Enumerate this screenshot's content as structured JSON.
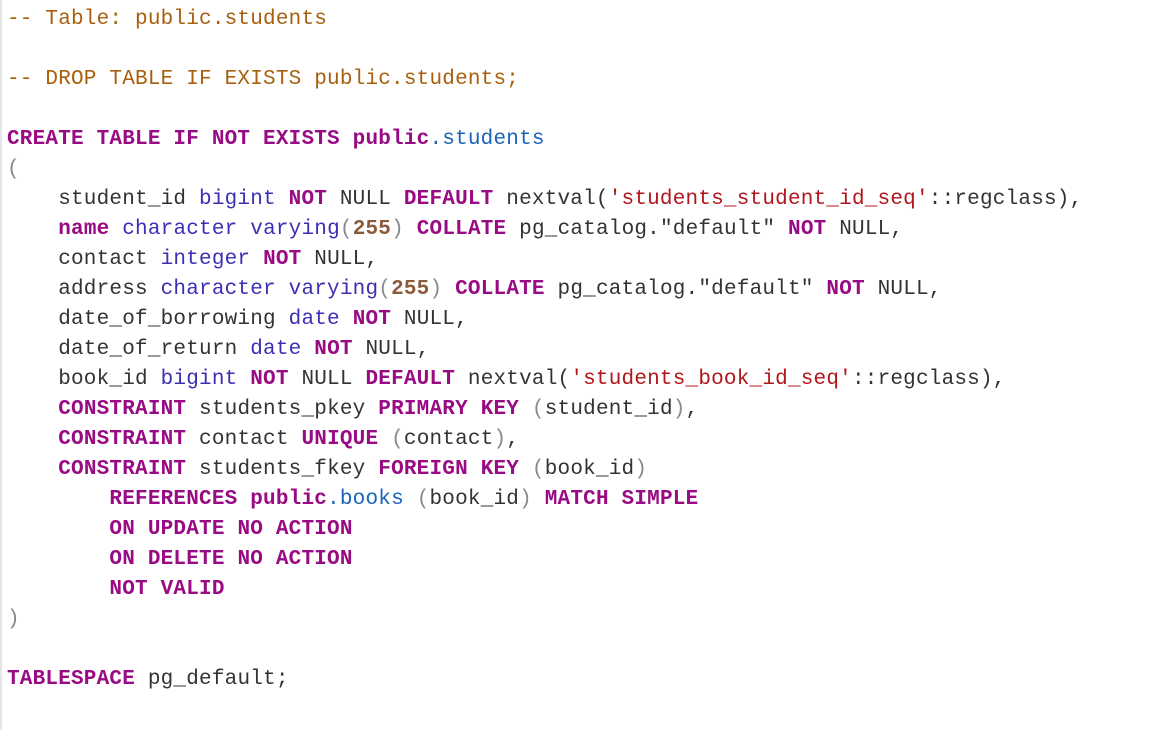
{
  "editor": {
    "colors": {
      "keyword": "#990b84",
      "type": "#3c2fb3",
      "number": "#8a5a3a",
      "string": "#b0161c",
      "comment": "#a8600e",
      "qualifier": "#1a63b8"
    },
    "lines": [
      [
        {
          "c": "cm",
          "t": "-- Table: public.students"
        }
      ],
      [],
      [
        {
          "c": "cm",
          "t": "-- DROP TABLE IF EXISTS public.students;"
        }
      ],
      [],
      [
        {
          "c": "kw",
          "t": "CREATE TABLE IF NOT EXISTS public"
        },
        {
          "c": "qual",
          "t": ".students"
        }
      ],
      [
        {
          "c": "paren",
          "t": "("
        }
      ],
      [
        {
          "c": "plain",
          "t": "    student_id "
        },
        {
          "c": "type",
          "t": "bigint"
        },
        {
          "c": "plain",
          "t": " "
        },
        {
          "c": "kw",
          "t": "NOT"
        },
        {
          "c": "plain",
          "t": " NULL "
        },
        {
          "c": "kw",
          "t": "DEFAULT"
        },
        {
          "c": "plain",
          "t": " nextval("
        },
        {
          "c": "str",
          "t": "'students_student_id_seq'"
        },
        {
          "c": "plain",
          "t": "::regclass),"
        }
      ],
      [
        {
          "c": "plain",
          "t": "    "
        },
        {
          "c": "kw",
          "t": "name"
        },
        {
          "c": "plain",
          "t": " "
        },
        {
          "c": "type",
          "t": "character varying"
        },
        {
          "c": "paren",
          "t": "("
        },
        {
          "c": "num",
          "t": "255"
        },
        {
          "c": "paren",
          "t": ")"
        },
        {
          "c": "plain",
          "t": " "
        },
        {
          "c": "kw",
          "t": "COLLATE"
        },
        {
          "c": "plain",
          "t": " pg_catalog.\"default\" "
        },
        {
          "c": "kw",
          "t": "NOT"
        },
        {
          "c": "plain",
          "t": " NULL,"
        }
      ],
      [
        {
          "c": "plain",
          "t": "    contact "
        },
        {
          "c": "type",
          "t": "integer"
        },
        {
          "c": "plain",
          "t": " "
        },
        {
          "c": "kw",
          "t": "NOT"
        },
        {
          "c": "plain",
          "t": " NULL,"
        }
      ],
      [
        {
          "c": "plain",
          "t": "    address "
        },
        {
          "c": "type",
          "t": "character varying"
        },
        {
          "c": "paren",
          "t": "("
        },
        {
          "c": "num",
          "t": "255"
        },
        {
          "c": "paren",
          "t": ")"
        },
        {
          "c": "plain",
          "t": " "
        },
        {
          "c": "kw",
          "t": "COLLATE"
        },
        {
          "c": "plain",
          "t": " pg_catalog.\"default\" "
        },
        {
          "c": "kw",
          "t": "NOT"
        },
        {
          "c": "plain",
          "t": " NULL,"
        }
      ],
      [
        {
          "c": "plain",
          "t": "    date_of_borrowing "
        },
        {
          "c": "type",
          "t": "date"
        },
        {
          "c": "plain",
          "t": " "
        },
        {
          "c": "kw",
          "t": "NOT"
        },
        {
          "c": "plain",
          "t": " NULL,"
        }
      ],
      [
        {
          "c": "plain",
          "t": "    date_of_return "
        },
        {
          "c": "type",
          "t": "date"
        },
        {
          "c": "plain",
          "t": " "
        },
        {
          "c": "kw",
          "t": "NOT"
        },
        {
          "c": "plain",
          "t": " NULL,"
        }
      ],
      [
        {
          "c": "plain",
          "t": "    book_id "
        },
        {
          "c": "type",
          "t": "bigint"
        },
        {
          "c": "plain",
          "t": " "
        },
        {
          "c": "kw",
          "t": "NOT"
        },
        {
          "c": "plain",
          "t": " NULL "
        },
        {
          "c": "kw",
          "t": "DEFAULT"
        },
        {
          "c": "plain",
          "t": " nextval("
        },
        {
          "c": "str",
          "t": "'students_book_id_seq'"
        },
        {
          "c": "plain",
          "t": "::regclass),"
        }
      ],
      [
        {
          "c": "plain",
          "t": "    "
        },
        {
          "c": "kw",
          "t": "CONSTRAINT"
        },
        {
          "c": "plain",
          "t": " students_pkey "
        },
        {
          "c": "kw",
          "t": "PRIMARY KEY"
        },
        {
          "c": "plain",
          "t": " "
        },
        {
          "c": "paren",
          "t": "("
        },
        {
          "c": "plain",
          "t": "student_id"
        },
        {
          "c": "paren",
          "t": ")"
        },
        {
          "c": "plain",
          "t": ","
        }
      ],
      [
        {
          "c": "plain",
          "t": "    "
        },
        {
          "c": "kw",
          "t": "CONSTRAINT"
        },
        {
          "c": "plain",
          "t": " contact "
        },
        {
          "c": "kw",
          "t": "UNIQUE"
        },
        {
          "c": "plain",
          "t": " "
        },
        {
          "c": "paren",
          "t": "("
        },
        {
          "c": "plain",
          "t": "contact"
        },
        {
          "c": "paren",
          "t": ")"
        },
        {
          "c": "plain",
          "t": ","
        }
      ],
      [
        {
          "c": "plain",
          "t": "    "
        },
        {
          "c": "kw",
          "t": "CONSTRAINT"
        },
        {
          "c": "plain",
          "t": " students_fkey "
        },
        {
          "c": "kw",
          "t": "FOREIGN KEY"
        },
        {
          "c": "plain",
          "t": " "
        },
        {
          "c": "paren",
          "t": "("
        },
        {
          "c": "plain",
          "t": "book_id"
        },
        {
          "c": "paren",
          "t": ")"
        }
      ],
      [
        {
          "c": "plain",
          "t": "        "
        },
        {
          "c": "kw",
          "t": "REFERENCES public"
        },
        {
          "c": "qual",
          "t": ".books"
        },
        {
          "c": "plain",
          "t": " "
        },
        {
          "c": "paren",
          "t": "("
        },
        {
          "c": "plain",
          "t": "book_id"
        },
        {
          "c": "paren",
          "t": ")"
        },
        {
          "c": "plain",
          "t": " "
        },
        {
          "c": "kw",
          "t": "MATCH SIMPLE"
        }
      ],
      [
        {
          "c": "plain",
          "t": "        "
        },
        {
          "c": "kw",
          "t": "ON UPDATE NO ACTION"
        }
      ],
      [
        {
          "c": "plain",
          "t": "        "
        },
        {
          "c": "kw",
          "t": "ON DELETE NO ACTION"
        }
      ],
      [
        {
          "c": "plain",
          "t": "        "
        },
        {
          "c": "kw",
          "t": "NOT VALID"
        }
      ],
      [
        {
          "c": "paren",
          "t": ")"
        }
      ],
      [],
      [
        {
          "c": "kw",
          "t": "TABLESPACE"
        },
        {
          "c": "plain",
          "t": " pg_default;"
        }
      ]
    ]
  }
}
